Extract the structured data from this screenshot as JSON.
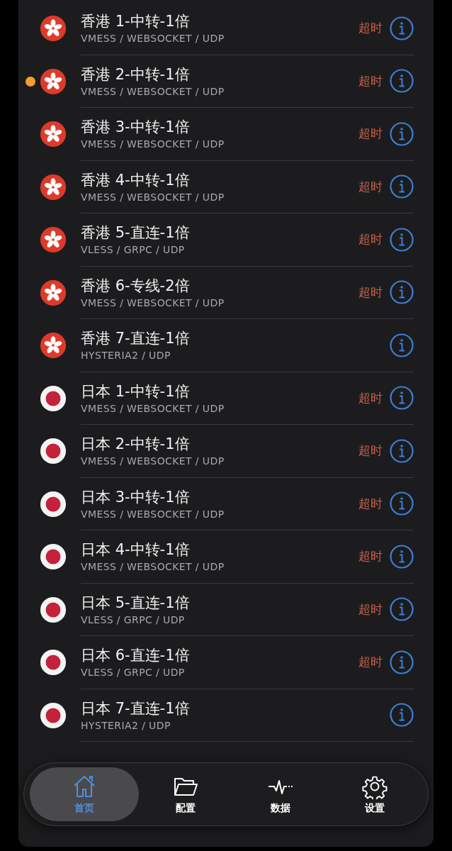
{
  "servers": [
    {
      "kind": "hk",
      "name": "香港 1-中转-1倍",
      "protocol": "VMESS / WEBSOCKET / UDP",
      "status": "超时",
      "active": false
    },
    {
      "kind": "hk",
      "name": "香港 2-中转-1倍",
      "protocol": "VMESS / WEBSOCKET / UDP",
      "status": "超时",
      "active": true
    },
    {
      "kind": "hk",
      "name": "香港 3-中转-1倍",
      "protocol": "VMESS / WEBSOCKET / UDP",
      "status": "超时",
      "active": false
    },
    {
      "kind": "hk",
      "name": "香港 4-中转-1倍",
      "protocol": "VMESS / WEBSOCKET / UDP",
      "status": "超时",
      "active": false
    },
    {
      "kind": "hk",
      "name": "香港 5-直连-1倍",
      "protocol": "VLESS / GRPC / UDP",
      "status": "超时",
      "active": false
    },
    {
      "kind": "hk",
      "name": "香港 6-专线-2倍",
      "protocol": "VMESS / WEBSOCKET / UDP",
      "status": "超时",
      "active": false
    },
    {
      "kind": "hk",
      "name": "香港 7-直连-1倍",
      "protocol": "HYSTERIA2 / UDP",
      "active": false
    },
    {
      "kind": "jp",
      "name": "日本 1-中转-1倍",
      "protocol": "VMESS / WEBSOCKET / UDP",
      "status": "超时",
      "active": false
    },
    {
      "kind": "jp",
      "name": "日本 2-中转-1倍",
      "protocol": "VMESS / WEBSOCKET / UDP",
      "status": "超时",
      "active": false
    },
    {
      "kind": "jp",
      "name": "日本 3-中转-1倍",
      "protocol": "VMESS / WEBSOCKET / UDP",
      "status": "超时",
      "active": false
    },
    {
      "kind": "jp",
      "name": "日本 4-中转-1倍",
      "protocol": "VMESS / WEBSOCKET / UDP",
      "status": "超时",
      "active": false
    },
    {
      "kind": "jp",
      "name": "日本 5-直连-1倍",
      "protocol": "VLESS / GRPC / UDP",
      "status": "超时",
      "active": false
    },
    {
      "kind": "jp",
      "name": "日本 6-直连-1倍",
      "protocol": "VLESS / GRPC / UDP",
      "status": "超时",
      "active": false
    },
    {
      "kind": "jp",
      "name": "日本 7-直连-1倍",
      "protocol": "HYSTERIA2 / UDP",
      "active": false
    }
  ],
  "tabs": [
    {
      "label": "首页",
      "selected": true
    },
    {
      "label": "配置",
      "selected": false
    },
    {
      "label": "数据",
      "selected": false
    },
    {
      "label": "设置",
      "selected": false
    }
  ]
}
